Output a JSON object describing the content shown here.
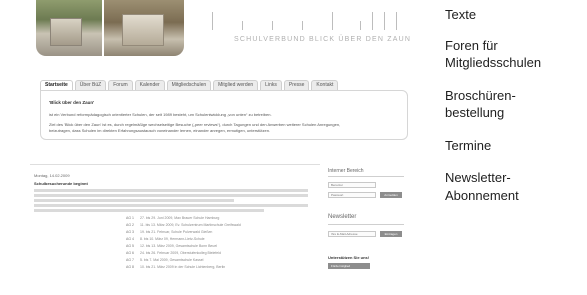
{
  "header": {
    "brand": "SCHULVERBUND  BLICK ÜBER DEN ZAUN"
  },
  "nav": {
    "tabs": [
      "Startseite",
      "Über BüZ",
      "Forum",
      "Kalender",
      "Mitgliedschulen",
      "Mitglied werden",
      "Links",
      "Presse",
      "Kontakt"
    ]
  },
  "intro": {
    "title": "'Blick über den Zaun'",
    "line1": "ist ein Verbund reformpädagogisch orientierter Schulen, der seit 1989 besteht, um Schulentwicklung „von unten“ zu betreiben.",
    "line2": "Ziel des 'Blick über den Zaun' ist es, durch regelmäßige wechselseitige Besuche („peer reviews“), durch Tagungen und den Anwerben weiterer Schulen Anregungen,",
    "line3": "beizutragen, dass Schulen im direkten Erfahrungsaustausch voneinander lernen, einander anregen, ermutigen, unterstützen."
  },
  "article": {
    "date": "Montag, 14.02.2009",
    "title": "Schulbesucherunde beginnt",
    "schedule": [
      {
        "no": "AG 1",
        "text": "27. bis 29. Juni 2009, Max Brauer Schule Hamburg"
      },
      {
        "no": "AG 2",
        "text": "11. bis 13. März 2009, Ev. Schulzentrum Martinschule Greifswald"
      },
      {
        "no": "AG 3",
        "text": "19. bis 21. Februar, Schule Pulverwald Gießen"
      },
      {
        "no": "AG 4",
        "text": "8. bis 10. März 09, Hermann-Lietz-Schule"
      },
      {
        "no": "AG 5",
        "text": "12. bis 13. März 2009, Gesamtschule Bonn Beuel"
      },
      {
        "no": "AG 6",
        "text": "24. bis 26. Februar 2009, Oberstufenkolleg Bielefeld"
      },
      {
        "no": "AG 7",
        "text": "5. bis 7. Mai 2009, Gesamtschule Kassel"
      },
      {
        "no": "AG 8",
        "text": "10. bis 21. März 2009 in der Schule Lichtenberg, Berlin"
      }
    ]
  },
  "sidebar": {
    "login_heading": "Interner Bereich",
    "user_placeholder": "Benutzer",
    "pass_placeholder": "Passwort",
    "login_btn": "Anmelden",
    "newsletter_heading": "Newsletter",
    "email_placeholder": "Ihre E-Mail-Adresse",
    "subscribe_btn": "Eintragen",
    "support_text": "Unterstützen Sie uns!",
    "support_btn": "Fördermitglied"
  },
  "right_menu": [
    "Texte",
    "Foren für",
    "Mitgliedsschulen",
    "Broschüren-",
    "bestellung",
    "Termine",
    "Newsletter-",
    "Abonnement"
  ]
}
